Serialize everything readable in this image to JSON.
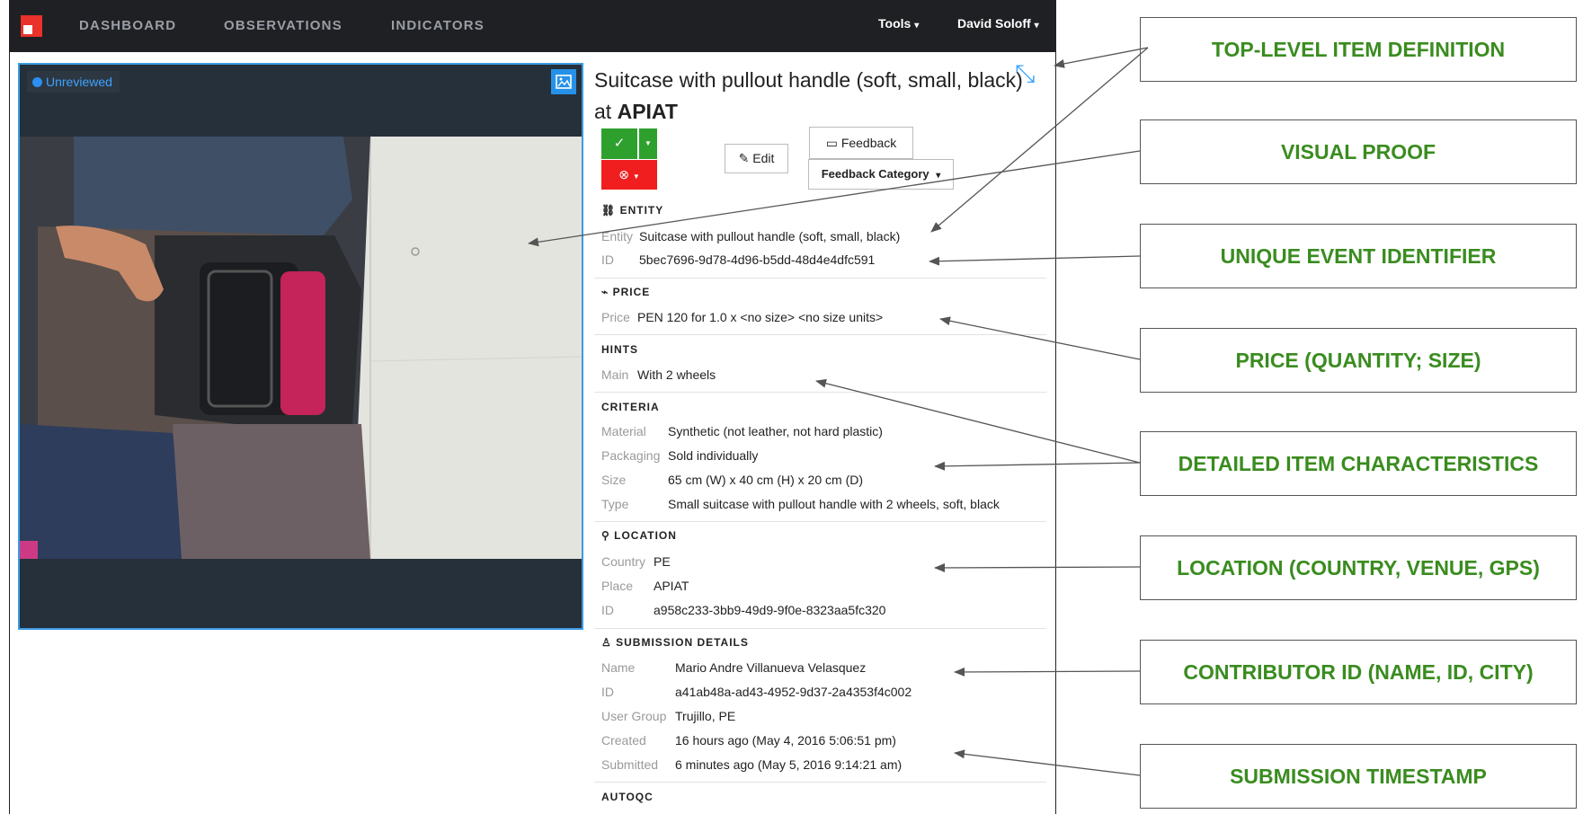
{
  "navbar": {
    "items": [
      "DASHBOARD",
      "OBSERVATIONS",
      "INDICATORS"
    ],
    "tools": "Tools",
    "user": "David Soloff"
  },
  "image_panel": {
    "status_badge": "Unreviewed"
  },
  "item": {
    "title_main": "Suitcase with pullout handle (soft, small, black)",
    "title_at": "at",
    "title_place": "APIAT"
  },
  "actions": {
    "approve": "✓",
    "reject": "⊗",
    "edit": "Edit",
    "feedback": "Feedback",
    "feedback_category": "Feedback Category"
  },
  "entity": {
    "heading": "ENTITY",
    "rows": [
      {
        "key": "Entity",
        "value": "Suitcase with pullout handle (soft, small, black)"
      },
      {
        "key": "ID",
        "value": "5bec7696-9d78-4d96-b5dd-48d4e4dfc591"
      }
    ]
  },
  "price": {
    "heading": "PRICE",
    "key": "Price",
    "value": "PEN 120 for 1.0 x <no size> <no size units>"
  },
  "hints": {
    "heading": "HINTS",
    "key": "Main",
    "value": "With 2 wheels"
  },
  "criteria": {
    "heading": "CRITERIA",
    "rows": [
      {
        "key": "Material",
        "value": "Synthetic (not leather, not hard plastic)"
      },
      {
        "key": "Packaging",
        "value": "Sold individually"
      },
      {
        "key": "Size",
        "value": "65 cm (W) x 40 cm (H) x 20 cm (D)"
      },
      {
        "key": "Type",
        "value": "Small suitcase with pullout handle with 2 wheels, soft, black"
      }
    ]
  },
  "location": {
    "heading": "LOCATION",
    "rows": [
      {
        "key": "Country",
        "value": "PE"
      },
      {
        "key": "Place",
        "value": "APIAT"
      },
      {
        "key": "ID",
        "value": "a958c233-3bb9-49d9-9f0e-8323aa5fc320"
      }
    ]
  },
  "submission": {
    "heading": "SUBMISSION DETAILS",
    "rows": [
      {
        "key": "Name",
        "value": "Mario Andre Villanueva Velasquez"
      },
      {
        "key": "ID",
        "value": "a41ab48a-ad43-4952-9d37-2a4353f4c002"
      },
      {
        "key": "User Group",
        "value": "Trujillo, PE"
      },
      {
        "key": "Created",
        "value": "16 hours ago (May 4, 2016 5:06:51 pm)"
      },
      {
        "key": "Submitted",
        "value": "6 minutes ago (May 5, 2016 9:14:21 am)"
      }
    ]
  },
  "autoqc": {
    "heading": "AUTOQC"
  },
  "annotations": [
    "TOP-LEVEL ITEM DEFINITION",
    "VISUAL PROOF",
    "UNIQUE EVENT IDENTIFIER",
    "PRICE (QUANTITY; SIZE)",
    "DETAILED ITEM CHARACTERISTICS",
    "LOCATION (COUNTRY, VENUE, GPS)",
    "CONTRIBUTOR ID (NAME, ID, CITY)",
    "SUBMISSION TIMESTAMP"
  ],
  "colors": {
    "annotation_text": "#3a8c1f",
    "approve": "#2ea02e",
    "reject": "#f01e1e",
    "accent": "#3ea3ff",
    "navbar": "#1f2023"
  }
}
